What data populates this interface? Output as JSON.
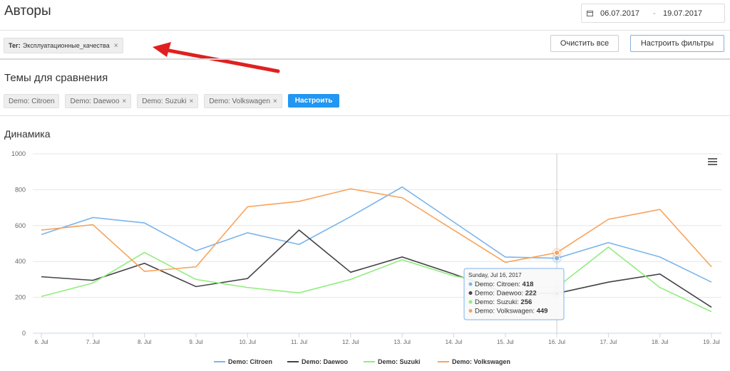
{
  "header": {
    "title": "Авторы",
    "date_from": "06.07.2017",
    "date_to": "19.07.2017",
    "date_sep": "-"
  },
  "filters": {
    "tag_label": "Тег:",
    "tag_value": "Эксплуатационные_качества",
    "remove": "×",
    "clear_all": "Очистить все",
    "configure_filters": "Настроить фильтры"
  },
  "themes": {
    "title": "Темы для сравнения",
    "items": [
      "Demo: Citroen",
      "Demo: Daewoo",
      "Demo: Suzuki",
      "Demo: Volkswagen"
    ],
    "setup_button": "Настроить"
  },
  "dynamics": {
    "title": "Динамика",
    "menu_icon": "hamburger-menu-icon"
  },
  "chart_data": {
    "type": "line",
    "title": "",
    "xlabel": "",
    "ylabel": "",
    "ylim": [
      0,
      1000
    ],
    "yticks": [
      "0",
      "200",
      "400",
      "600",
      "800",
      "1000"
    ],
    "categories": [
      "6. Jul",
      "7. Jul",
      "8. Jul",
      "9. Jul",
      "10. Jul",
      "11. Jul",
      "12. Jul",
      "13. Jul",
      "14. Jul",
      "15. Jul",
      "16. Jul",
      "17. Jul",
      "18. Jul",
      "19. Jul"
    ],
    "legend_position": "bottom",
    "grid": true,
    "series": [
      {
        "name": "Demo: Citroen",
        "color": "#7cb5ec",
        "values": [
          550,
          645,
          615,
          460,
          560,
          495,
          650,
          815,
          620,
          425,
          418,
          505,
          425,
          285
        ]
      },
      {
        "name": "Demo: Daewoo",
        "color": "#434348",
        "values": [
          315,
          295,
          390,
          260,
          305,
          575,
          340,
          425,
          330,
          225,
          222,
          285,
          330,
          145
        ]
      },
      {
        "name": "Demo: Suzuki",
        "color": "#90ed7d",
        "values": [
          205,
          280,
          450,
          300,
          255,
          225,
          300,
          410,
          320,
          265,
          256,
          480,
          255,
          120
        ]
      },
      {
        "name": "Demo: Volkswagen",
        "color": "#f7a35c",
        "values": [
          575,
          605,
          345,
          370,
          705,
          735,
          805,
          755,
          575,
          395,
          449,
          635,
          690,
          370
        ]
      }
    ],
    "tooltip": {
      "header": "Sunday, Jul 16, 2017",
      "rows": [
        {
          "label": "Demo: Citroen:",
          "value": "418"
        },
        {
          "label": "Demo: Daewoo:",
          "value": "222"
        },
        {
          "label": "Demo: Suzuki:",
          "value": "256"
        },
        {
          "label": "Demo: Volkswagen:",
          "value": "449"
        }
      ]
    }
  }
}
